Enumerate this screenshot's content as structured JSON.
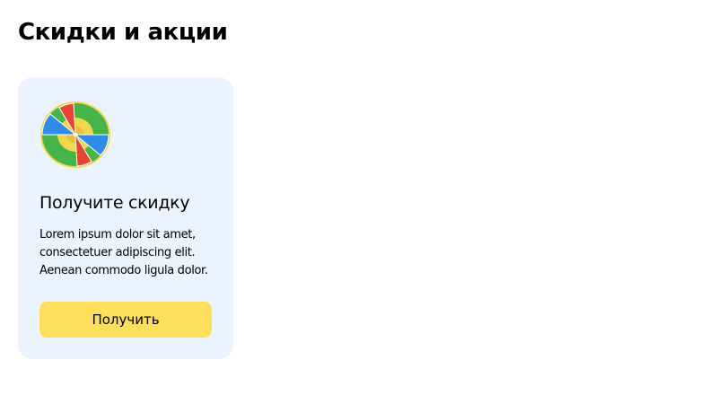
{
  "page": {
    "title": "Скидки и акции"
  },
  "promo_card": {
    "icon": "fortune-wheel-icon",
    "title": "Получите скидку",
    "description_lines": [
      "Lorem ipsum dolor sit amet,",
      "consectetuer adipiscing elit.",
      "Aenean commodo ligula dolor."
    ],
    "button_label": "Получить"
  },
  "colors": {
    "card_background": "#ebf3fe",
    "button_background": "#fedf5b",
    "wheel_green": "#46b549",
    "wheel_red": "#ea4335",
    "wheel_blue": "#2e8de8",
    "wheel_yellow": "#f2d64b"
  }
}
